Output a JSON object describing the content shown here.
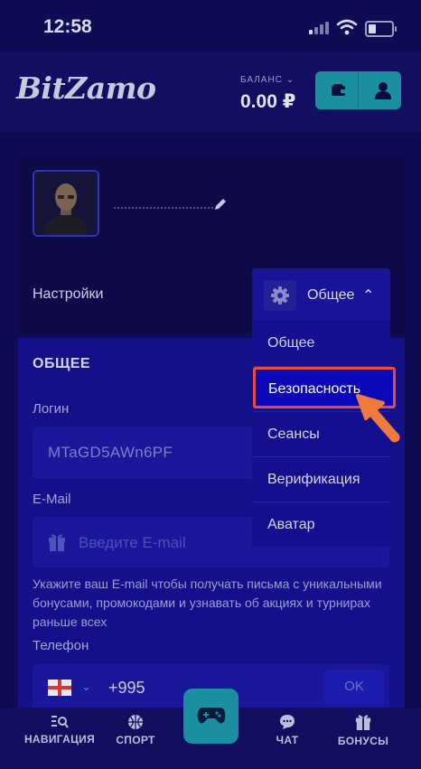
{
  "status_bar": {
    "time": "12:58"
  },
  "header": {
    "logo": "BitZamo",
    "balance_label": "БАЛАНС",
    "balance_amount": "0.00 ₽"
  },
  "profile": {
    "settings_label": "Настройки"
  },
  "dropdown": {
    "selected": "Общее",
    "items": [
      "Общее",
      "Безопасность",
      "Сеансы",
      "Верификация",
      "Аватар"
    ],
    "highlighted_index": 1,
    "highlight_color": "#e84a3c"
  },
  "form": {
    "section_title": "ОБЩЕЕ",
    "login_label": "Логин",
    "login_value": "MTaGD5AWn6PF",
    "email_label": "E-Mail",
    "email_placeholder": "Введите E-mail",
    "email_hint": "Укажите ваш E-mail чтобы получать письма с уникальными бонусами, промокодами и узнавать об акциях и турнирах раньше всех",
    "phone_label": "Телефон",
    "phone_code": "+995",
    "ok_label": "OK"
  },
  "bottom_nav": {
    "items": [
      "НАВИГАЦИЯ",
      "СПОРТ",
      "ЧАТ",
      "БОНУСЫ"
    ]
  },
  "colors": {
    "background": "#0f0c55",
    "accent_teal": "#1a8fa0",
    "arrow_orange": "#f07a3c"
  }
}
